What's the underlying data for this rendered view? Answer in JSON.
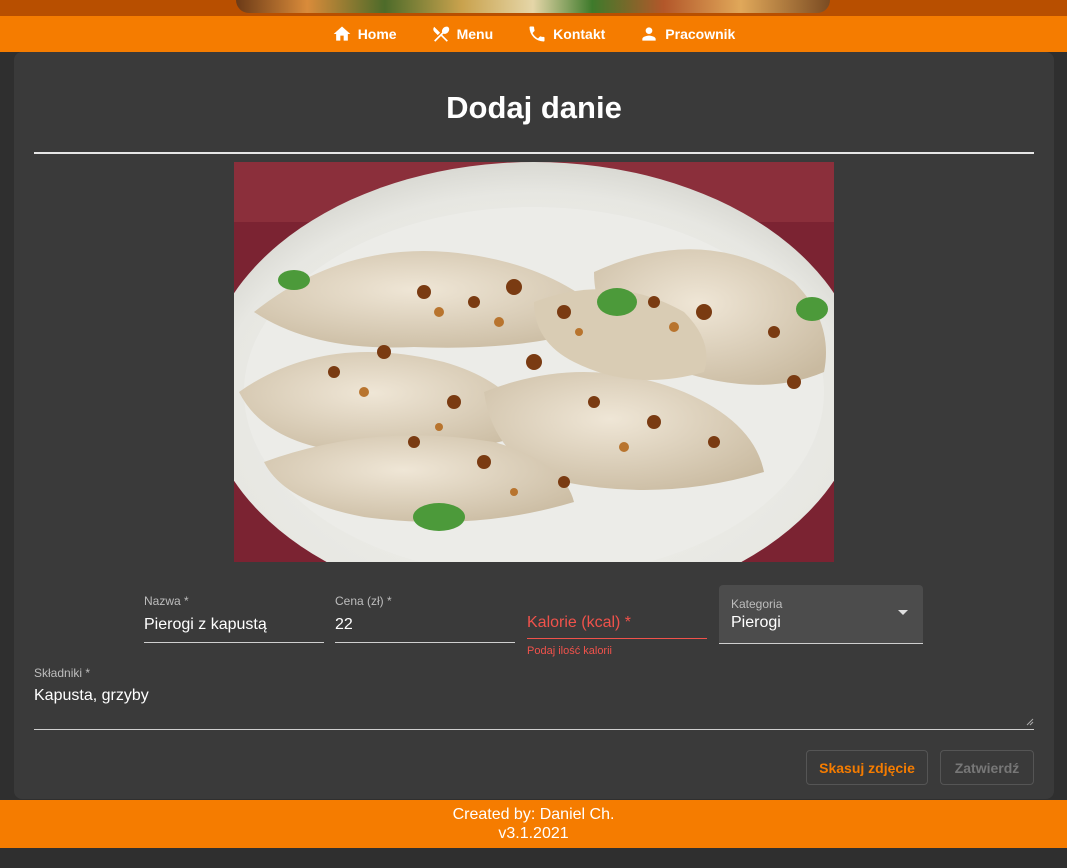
{
  "nav": {
    "items": [
      {
        "label": "Home",
        "icon": "home-icon"
      },
      {
        "label": "Menu",
        "icon": "cutlery-icon"
      },
      {
        "label": "Kontakt",
        "icon": "phone-icon"
      },
      {
        "label": "Pracownik",
        "icon": "person-icon"
      }
    ]
  },
  "page": {
    "title": "Dodaj danie"
  },
  "form": {
    "nazwa": {
      "label": "Nazwa *",
      "value": "Pierogi z kapustą"
    },
    "cena": {
      "label": "Cena (zł) *",
      "value": "22"
    },
    "kalorie": {
      "label": "Kalorie (kcal) *",
      "value": "",
      "error": "Podaj ilość kalorii"
    },
    "kategoria": {
      "label": "Kategoria",
      "value": "Pierogi"
    },
    "skladniki": {
      "label": "Składniki *",
      "value": "Kapusta, grzyby"
    }
  },
  "buttons": {
    "skasuj": "Skasuj zdjęcie",
    "zatwierdz": "Zatwierdź"
  },
  "footer": {
    "created": "Created by: Daniel Ch.",
    "version": "v3.1.2021"
  },
  "colors": {
    "accent": "#f57c00",
    "error": "#f0524b",
    "card": "#3a3a3a",
    "background": "#2f2f2f"
  }
}
